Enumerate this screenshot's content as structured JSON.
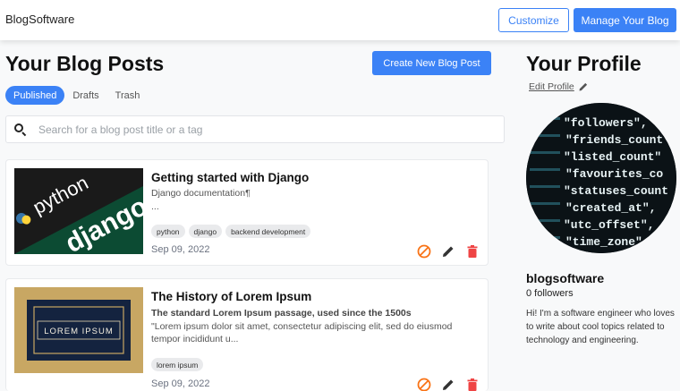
{
  "header": {
    "brand": "BlogSoftware",
    "customize_label": "Customize",
    "manage_label": "Manage Your Blog"
  },
  "main": {
    "title": "Your Blog Posts",
    "create_label": "Create New Blog Post",
    "tabs": [
      {
        "label": "Published",
        "active": true
      },
      {
        "label": "Drafts",
        "active": false
      },
      {
        "label": "Trash",
        "active": false
      }
    ],
    "search_placeholder": "Search for a blog post title or a tag",
    "posts": [
      {
        "title": "Getting started with Django",
        "subtitle": "Django documentation¶",
        "description": "...",
        "tags": [
          "python",
          "django",
          "backend development"
        ],
        "date": "Sep 09, 2022",
        "thumb_text_top": "python",
        "thumb_text_bottom": "django"
      },
      {
        "title": "The History of Lorem Ipsum",
        "subtitle": "The standard Lorem Ipsum passage, used since the 1500s",
        "description": "\"Lorem ipsum dolor sit amet, consectetur adipiscing elit, sed do eiusmod tempor incididunt u...",
        "tags": [
          "lorem ipsum"
        ],
        "date": "Sep 09, 2022",
        "thumb_text": "LOREM IPSUM"
      }
    ]
  },
  "profile": {
    "title": "Your Profile",
    "edit_label": "Edit Profile",
    "username": "blogsoftware",
    "followers": "0 followers",
    "bio": "Hi! I'm a software engineer who loves to write about cool topics related to technology and engineering.",
    "avatar_lines": [
      "\"followers\",",
      "\"friends_count\"",
      "\"listed_count\"",
      "\"favourites_co",
      "\"statuses_count",
      "\"created_at\",",
      "\"utc_offset\",",
      "\"time_zone\""
    ]
  },
  "colors": {
    "accent": "#3b82f6",
    "unpublish_icon": "#f97316",
    "delete_icon": "#ef4444"
  },
  "icons": [
    "search-icon",
    "pencil-icon",
    "unpublish-icon",
    "trash-icon"
  ]
}
